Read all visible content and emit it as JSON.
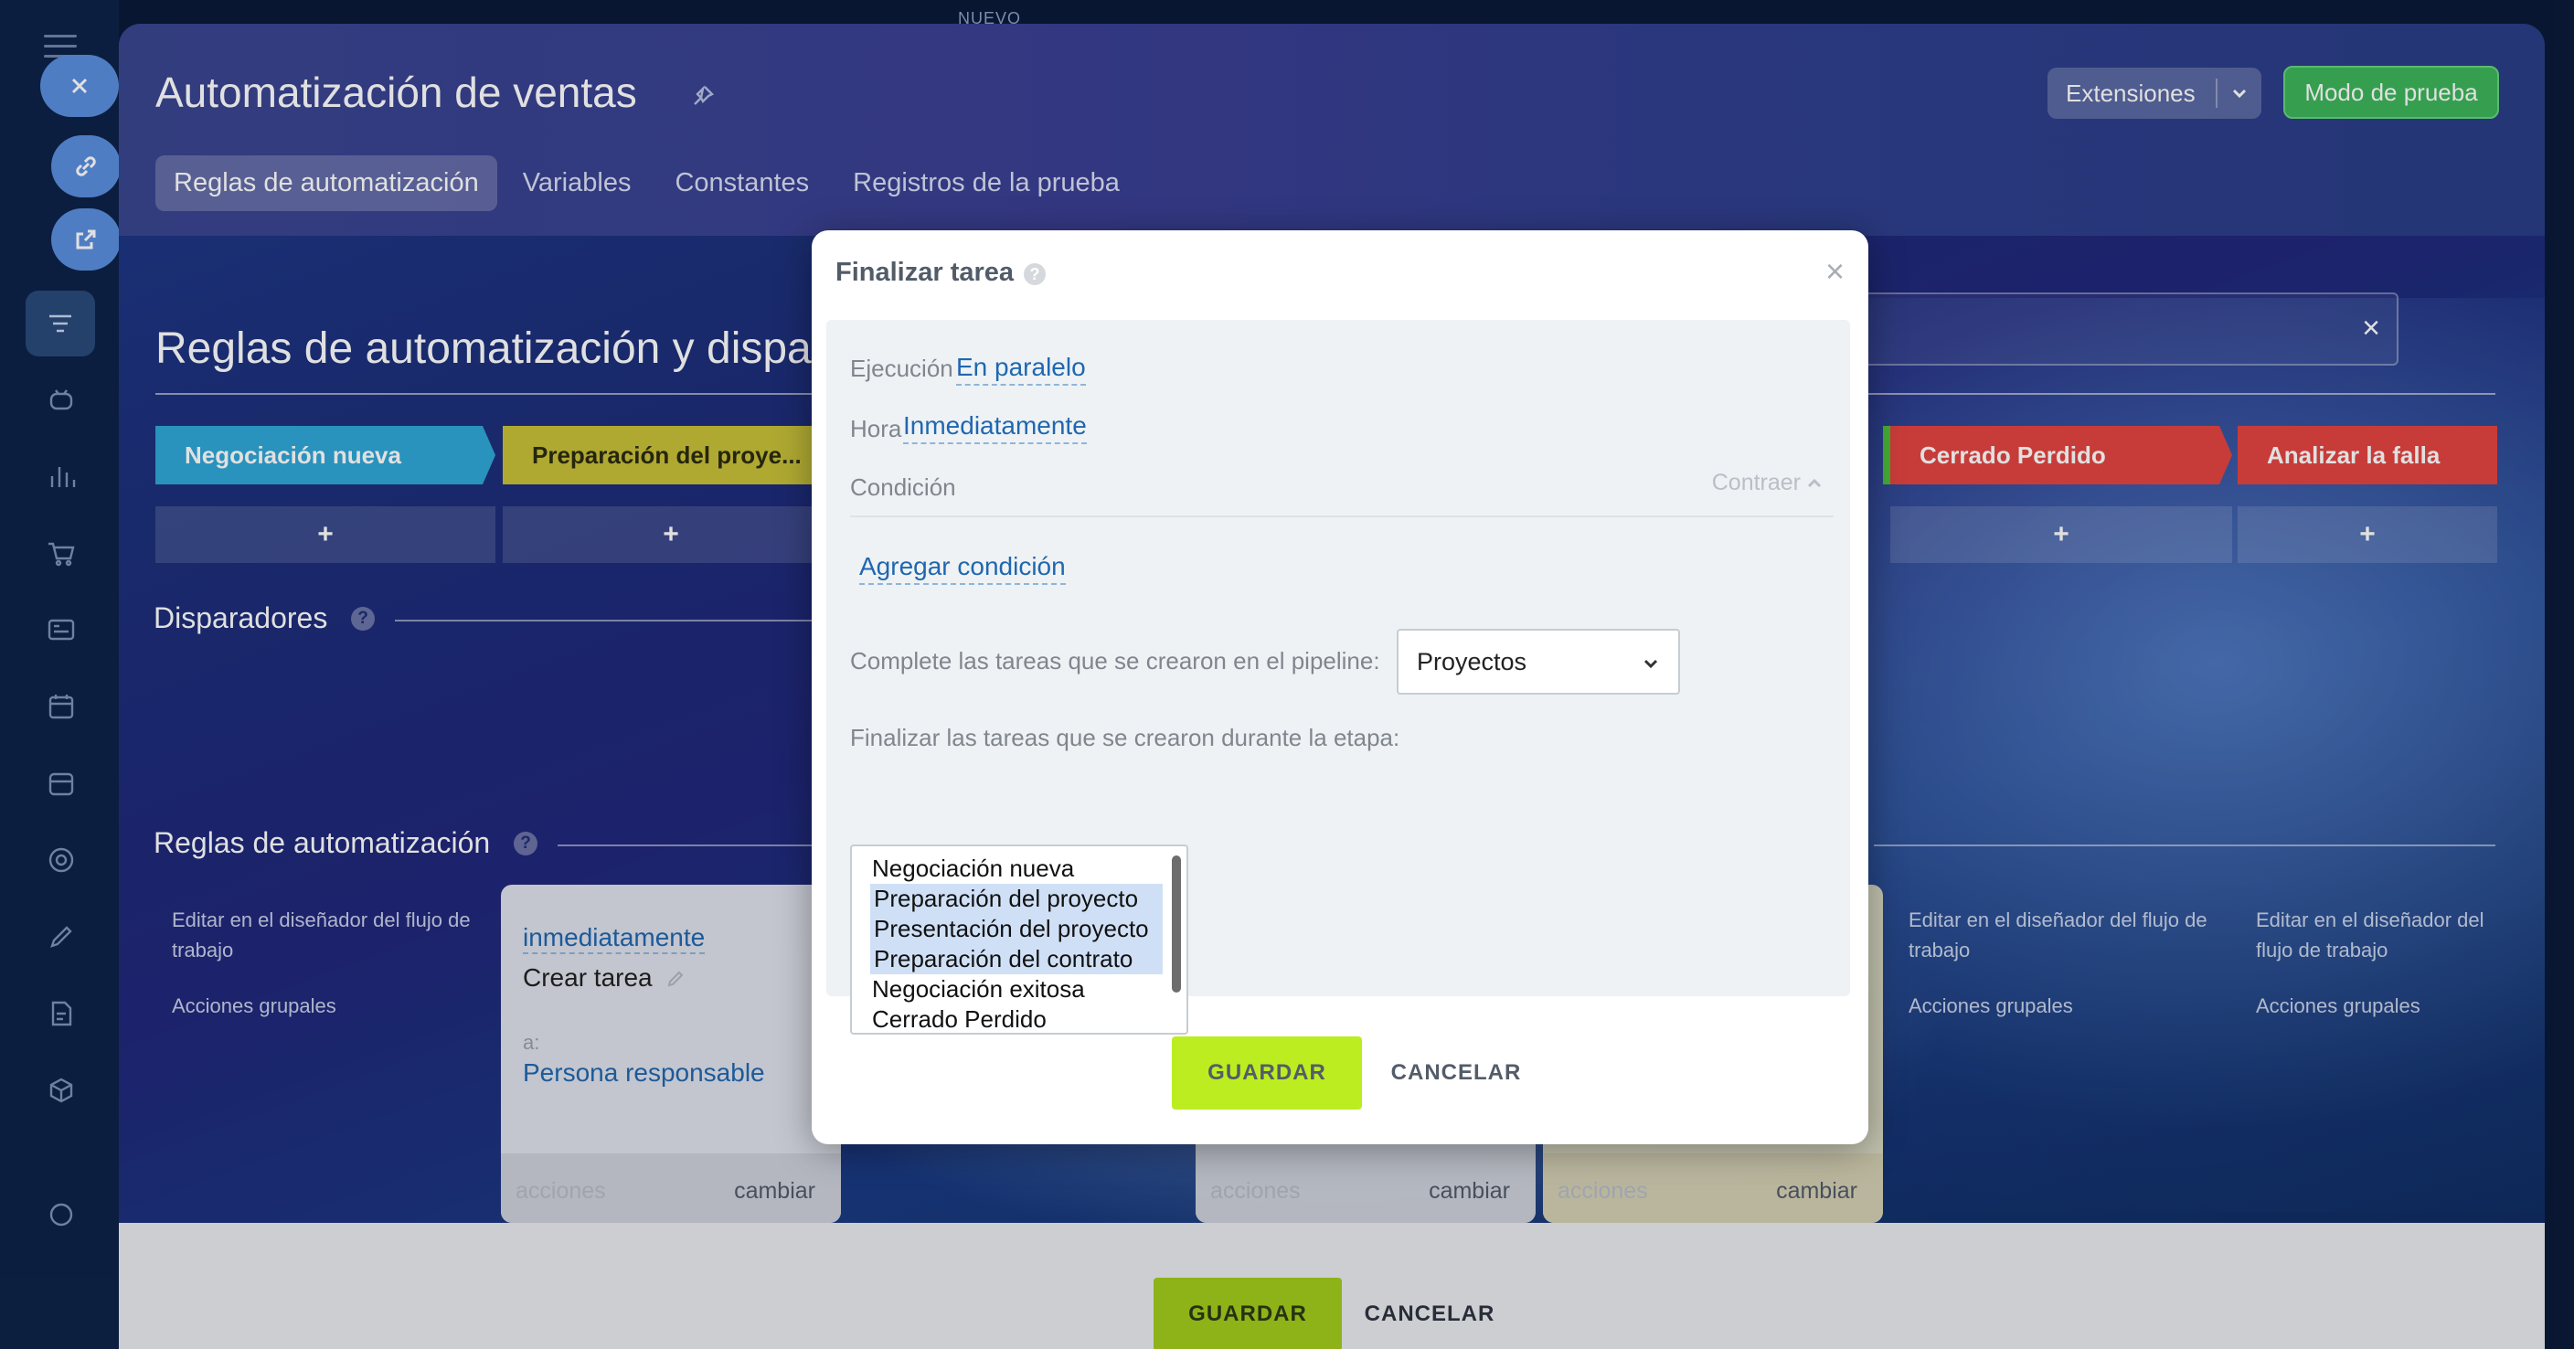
{
  "page": {
    "title": "Automatización de ventas",
    "top_label": "NUEVO",
    "tabs": [
      {
        "label": "Reglas de automatización"
      },
      {
        "label": "Variables"
      },
      {
        "label": "Constantes"
      },
      {
        "label": "Registros de la prueba"
      }
    ],
    "extensions_label": "Extensiones",
    "test_mode_label": "Modo de prueba",
    "section_title": "Reglas de automatización y disparadores",
    "section_title_visible": "Reglas de automatización y dispa",
    "search_clear": "×"
  },
  "stages": [
    {
      "label": "Negociación nueva",
      "color": "#2fa7d8"
    },
    {
      "label": "Preparación del proye...",
      "color": "#c8c13a"
    },
    {
      "label": "Cerrado Perdido",
      "color": "#e34541"
    },
    {
      "label": "Analizar la falla",
      "color": "#e34541"
    }
  ],
  "plus": "+",
  "triggers": {
    "title": "Disparadores",
    "help": "?"
  },
  "rules": {
    "title": "Reglas de automatización",
    "help": "?",
    "edit_text": "Editar en el diseñador del flujo de trabajo",
    "group_actions": "Acciones grupales"
  },
  "card": {
    "time": "inmediatamente",
    "action": "Crear tarea",
    "to_label": "a:",
    "to_value": "Persona responsable",
    "actions_label": "acciones",
    "change_label": "cambiar"
  },
  "footer": {
    "save": "GUARDAR",
    "cancel": "CANCELAR"
  },
  "modal": {
    "title": "Finalizar tarea",
    "help": "?",
    "close": "×",
    "execution_label": "Ejecución",
    "execution_value": "En paralelo",
    "time_label": "Hora",
    "time_value": "Inmediatamente",
    "condition_label": "Condición",
    "collapse_label": "Contraer",
    "add_condition": "Agregar condición",
    "pipeline_label": "Complete las tareas que se crearon en el pipeline:",
    "pipeline_value": "Proyectos",
    "stage_label": "Finalizar las tareas que se crearon durante la etapa:",
    "stage_options": [
      {
        "label": "Negociación nueva",
        "selected": false
      },
      {
        "label": "Preparación del proyecto",
        "selected": true
      },
      {
        "label": "Presentación del proyecto",
        "selected": true
      },
      {
        "label": "Preparación del contrato",
        "selected": true
      },
      {
        "label": "Negociación exitosa",
        "selected": false
      },
      {
        "label": "Cerrado Perdido",
        "selected": false
      }
    ],
    "save": "GUARDAR",
    "cancel": "CANCELAR"
  }
}
